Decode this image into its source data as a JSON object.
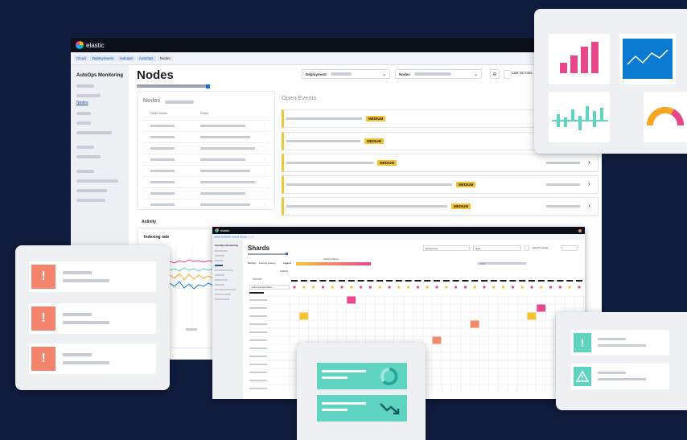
{
  "main_window": {
    "brand": "elastic",
    "breadcrumbs": [
      "Cloud",
      "Deployments",
      "autoops",
      "AutoOps",
      "Nodes"
    ],
    "sidebar_title": "AutoOps Monitoring",
    "sidebar_active": "Nodes",
    "page_title": "Nodes",
    "deployment_label": "Deployment",
    "nodes_label": "Nodes",
    "time_range": "Last 15 mins",
    "nodes_panel": {
      "title": "Nodes",
      "col_name": "Node Name",
      "col_roles": "Roles"
    },
    "events_title": "Open Events",
    "events": [
      {
        "badge": "MEDIUM"
      },
      {
        "badge": "MEDIUM"
      },
      {
        "badge": "MEDIUM"
      },
      {
        "badge": "MEDIUM"
      },
      {
        "badge": "MEDIUM"
      }
    ],
    "activity_title": "Activity",
    "indexing_rate_title": "Indexing rate"
  },
  "shards_window": {
    "brand": "elastic",
    "sidebar_title": "AutoOps Monitoring",
    "page_title": "Shards",
    "deployment_label": "Deployment",
    "node_label": "Node",
    "time_range": "Last 15 minutes",
    "sort_by_label": "Sort by:",
    "sort_by_value": "Indexing Latency",
    "legend_label": "Legend",
    "legend_scale": "Indexing Latency",
    "nodes_header": "NODES",
    "indices_header": "INDICES",
    "select_index_label": "Select sample indices"
  },
  "colors": {
    "background": "#101c3d",
    "medium_badge": "#f5c431",
    "heat_pink": "#e8488b",
    "heat_orange": "#f28a6a",
    "heat_yellow": "#f5b000",
    "bar_pink": "#e8488b",
    "line_blue": "#0b7ad1",
    "teal": "#5fd4c1",
    "alert_salmon": "#f4846c",
    "card": "#eef0f4"
  },
  "chart_thumbnails": [
    "bar-chart-icon",
    "line-chart-icon",
    "waterfall-chart-icon",
    "gauge-icon"
  ],
  "alert_icons": [
    "exclamation-icon",
    "warning-triangle-icon"
  ]
}
